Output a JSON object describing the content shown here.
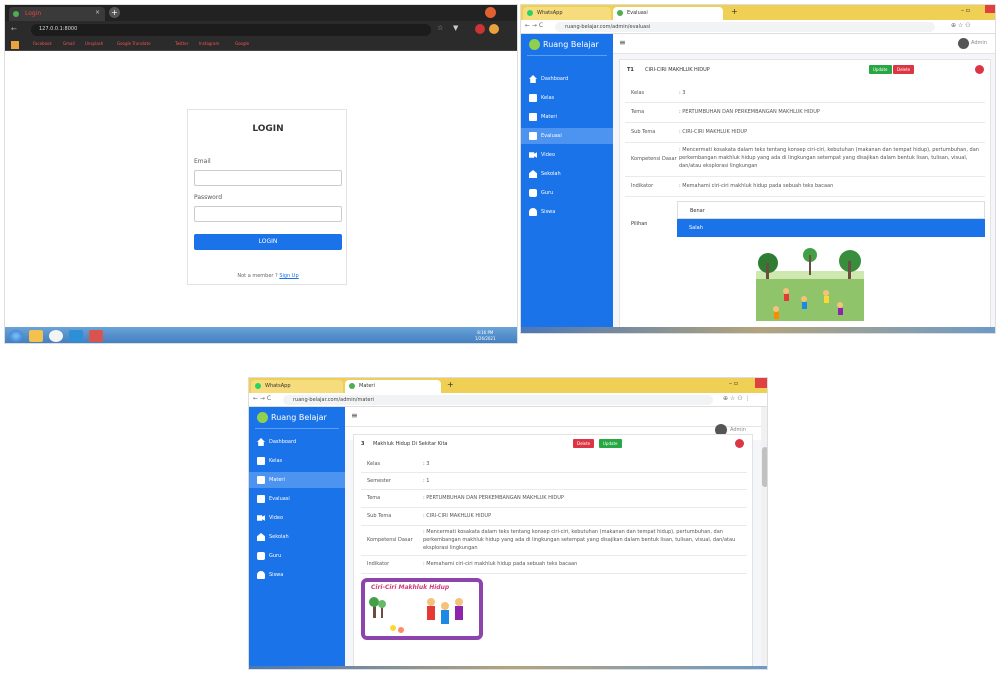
{
  "login_window": {
    "tab_label": "Login",
    "url": "127.0.0.1:8000",
    "bookmarks": [
      "Facebook",
      "Gmail",
      "Unsplash",
      "Google Translate",
      "Twitter",
      "Instagram",
      "Google"
    ],
    "heading": "LOGIN",
    "email_label": "Email",
    "password_label": "Password",
    "login_button": "LOGIN",
    "register_prompt": "Not a member ?",
    "register_link": "Sign Up",
    "clock_time": "8:16 PM",
    "clock_date": "1/26/2021"
  },
  "evaluasi_window": {
    "tabs": [
      "WhatsApp",
      "Evaluasi"
    ],
    "url": "ruang-belajar.com/admin/evaluasi",
    "brand": "Ruang Belajar",
    "user": "Admin",
    "nav": [
      "Dashboard",
      "Kelas",
      "Materi",
      "Evaluasi",
      "Video",
      "Sekolah",
      "Guru",
      "Siswa"
    ],
    "active_nav": "Evaluasi",
    "item_no": "T1",
    "item_title": "CIRI-CIRI MAKHLUK HIDUP",
    "update_label": "Update",
    "delete_label": "Delete",
    "rows": [
      {
        "key": "Kelas",
        "value": ": 3"
      },
      {
        "key": "Tema",
        "value": ": PERTUMBUHAN DAN PERKEMBANGAN MAKHLUK HIDUP"
      },
      {
        "key": "Sub Tema",
        "value": ": CIRI-CIRI MAKHLUK HIDUP"
      },
      {
        "key": "Kompetensi Dasar",
        "value": ": Mencermati kosakata dalam teks tentang konsep ciri-ciri, kebutuhan (makanan dan tempat hidup), pertumbuhan, dan perkembangan makhluk hidup yang ada di lingkungan setempat yang disajikan dalam bentuk lisan, tulisan, visual, dan/atau eksplorasi lingkungan"
      },
      {
        "key": "Indikator",
        "value": ": Memahami ciri-ciri makhluk hidup pada sebuah teks bacaan"
      }
    ],
    "choice_label": "Pilihan",
    "choices": [
      "Benar",
      "Salah"
    ],
    "selected_choice": "Salah"
  },
  "materi_window": {
    "tabs": [
      "WhatsApp",
      "Materi"
    ],
    "url": "ruang-belajar.com/admin/materi",
    "brand": "Ruang Belajar",
    "user": "Admin",
    "nav": [
      "Dashboard",
      "Kelas",
      "Materi",
      "Evaluasi",
      "Video",
      "Sekolah",
      "Guru",
      "Siswa"
    ],
    "active_nav": "Materi",
    "item_no": "3",
    "item_title": "Makhluk Hidup Di Sekitar Kita",
    "delete_label": "Delete",
    "update_label": "Update",
    "rows": [
      {
        "key": "Kelas",
        "value": ": 3"
      },
      {
        "key": "Semester",
        "value": ": 1"
      },
      {
        "key": "Tema",
        "value": ": PERTUMBUHAN DAN PERKEMBANGAN MAKHLUK HIDUP"
      },
      {
        "key": "Sub Tema",
        "value": ": CIRI-CIRI MAKHLUK HIDUP"
      },
      {
        "key": "Kompetensi Dasar",
        "value": ": Mencermati kosakata dalam teks tentang konsep ciri-ciri, kebutuhan (makanan dan tempat hidup), pertumbuhan, dan perkembangan makhluk hidup yang ada di lingkungan setempat yang disajikan dalam bentuk lisan, tulisan, visual, dan/atau eksplorasi lingkungan"
      },
      {
        "key": "Indikator",
        "value": ": Memahami ciri-ciri makhluk hidup pada sebuah teks bacaan"
      }
    ],
    "image_caption": "Ciri-Ciri Makhluk Hidup"
  },
  "colors": {
    "primary": "#1a73e8",
    "sidebar_active": "#4d93f0",
    "update_green": "#28a745",
    "delete_red": "#dc3545",
    "chrome_tabbar": "#f0cf55"
  }
}
